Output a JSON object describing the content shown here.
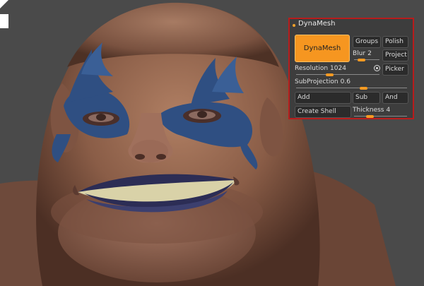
{
  "panel": {
    "title": "DynaMesh",
    "dynamesh_label": "DynaMesh",
    "groups_label": "Groups",
    "polish_label": "Polish",
    "blur_label": "Blur",
    "blur_value": "2",
    "blur_level": 0.3,
    "project_label": "Project",
    "resolution_label": "Resolution",
    "resolution_value": "1024",
    "resolution_level": 0.4,
    "picker_label": "Picker",
    "subprojection_label": "SubProjection",
    "subprojection_value": "0.6",
    "subprojection_level": 0.6,
    "add_label": "Add",
    "sub_label": "Sub",
    "and_label": "And",
    "create_shell_label": "Create Shell",
    "thickness_label": "Thickness",
    "thickness_value": "4",
    "thickness_level": 0.3
  },
  "colors": {
    "accent": "#f69620",
    "panel_border": "#b81c1c",
    "panel_bg": "#3d3d3d",
    "button_bg": "#2b2b2b"
  },
  "icons": {
    "corner": "white-bracket-icon",
    "picker_radio": "radio-target-icon"
  }
}
